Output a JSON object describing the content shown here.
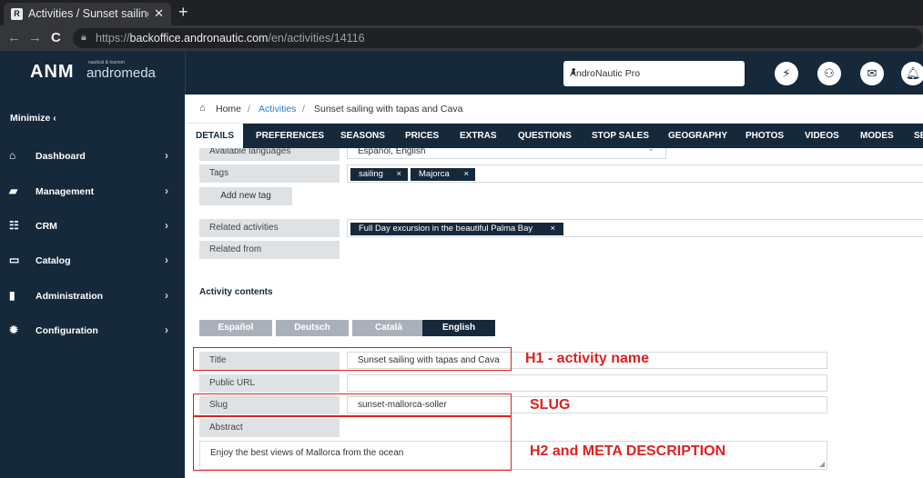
{
  "browser": {
    "tab_title": "Activities / Sunset sailing",
    "favicon": "R",
    "url_prefix": "https://",
    "url_domain": "backoffice.andronautic.com",
    "url_path": "/en/activities/14116"
  },
  "header": {
    "logo_mark": "ANM",
    "logo_tagline": "nautical & tourism",
    "logo_word": "andromeda",
    "account_select": "AndroNautic Pro"
  },
  "sidebar": {
    "minimize": "Minimize ‹",
    "items": [
      {
        "label": "Dashboard",
        "icon": "home-icon"
      },
      {
        "label": "Management",
        "icon": "folder-icon"
      },
      {
        "label": "CRM",
        "icon": "users-icon"
      },
      {
        "label": "Catalog",
        "icon": "catalog-icon"
      },
      {
        "label": "Administration",
        "icon": "book-icon"
      },
      {
        "label": "Configuration",
        "icon": "gear-icon"
      }
    ]
  },
  "breadcrumb": {
    "home": "Home",
    "sep": "/",
    "activities": "Activities",
    "current": "Sunset sailing with tapas and Cava"
  },
  "tabs": [
    "DETAILS",
    "PREFERENCES",
    "SEASONS",
    "PRICES",
    "EXTRAS",
    "QUESTIONS",
    "STOP SALES",
    "GEOGRAPHY",
    "PHOTOS",
    "VIDEOS",
    "MODES",
    "SE"
  ],
  "form": {
    "available_languages_label": "Available languages",
    "available_languages_value": "Español, English",
    "tags_label": "Tags",
    "tags": [
      "sailing",
      "Majorca"
    ],
    "add_tag": "Add new tag",
    "related_activities_label": "Related activities",
    "related_activities": [
      "Full Day excursion in the beautiful Palma Bay"
    ],
    "related_from_label": "Related from"
  },
  "contents": {
    "section_title": "Activity contents",
    "languages": [
      "Español",
      "Deutsch",
      "Català",
      "English"
    ],
    "active_language": "English",
    "title_label": "Title",
    "title_value": "Sunset sailing with tapas and Cava",
    "public_url_label": "Public URL",
    "public_url_value": "",
    "slug_label": "Slug",
    "slug_value": "sunset-mallorca-soller",
    "abstract_label": "Abstract",
    "abstract_value": "Enjoy the best views of Mallorca from the ocean"
  },
  "annotations": {
    "h1": "H1 - activity name",
    "slug": "SLUG",
    "h2": "H2 and META DESCRIPTION",
    "color": "#e02020"
  },
  "colors": {
    "navy": "#16293b",
    "label_bg": "#dfe2e5"
  }
}
